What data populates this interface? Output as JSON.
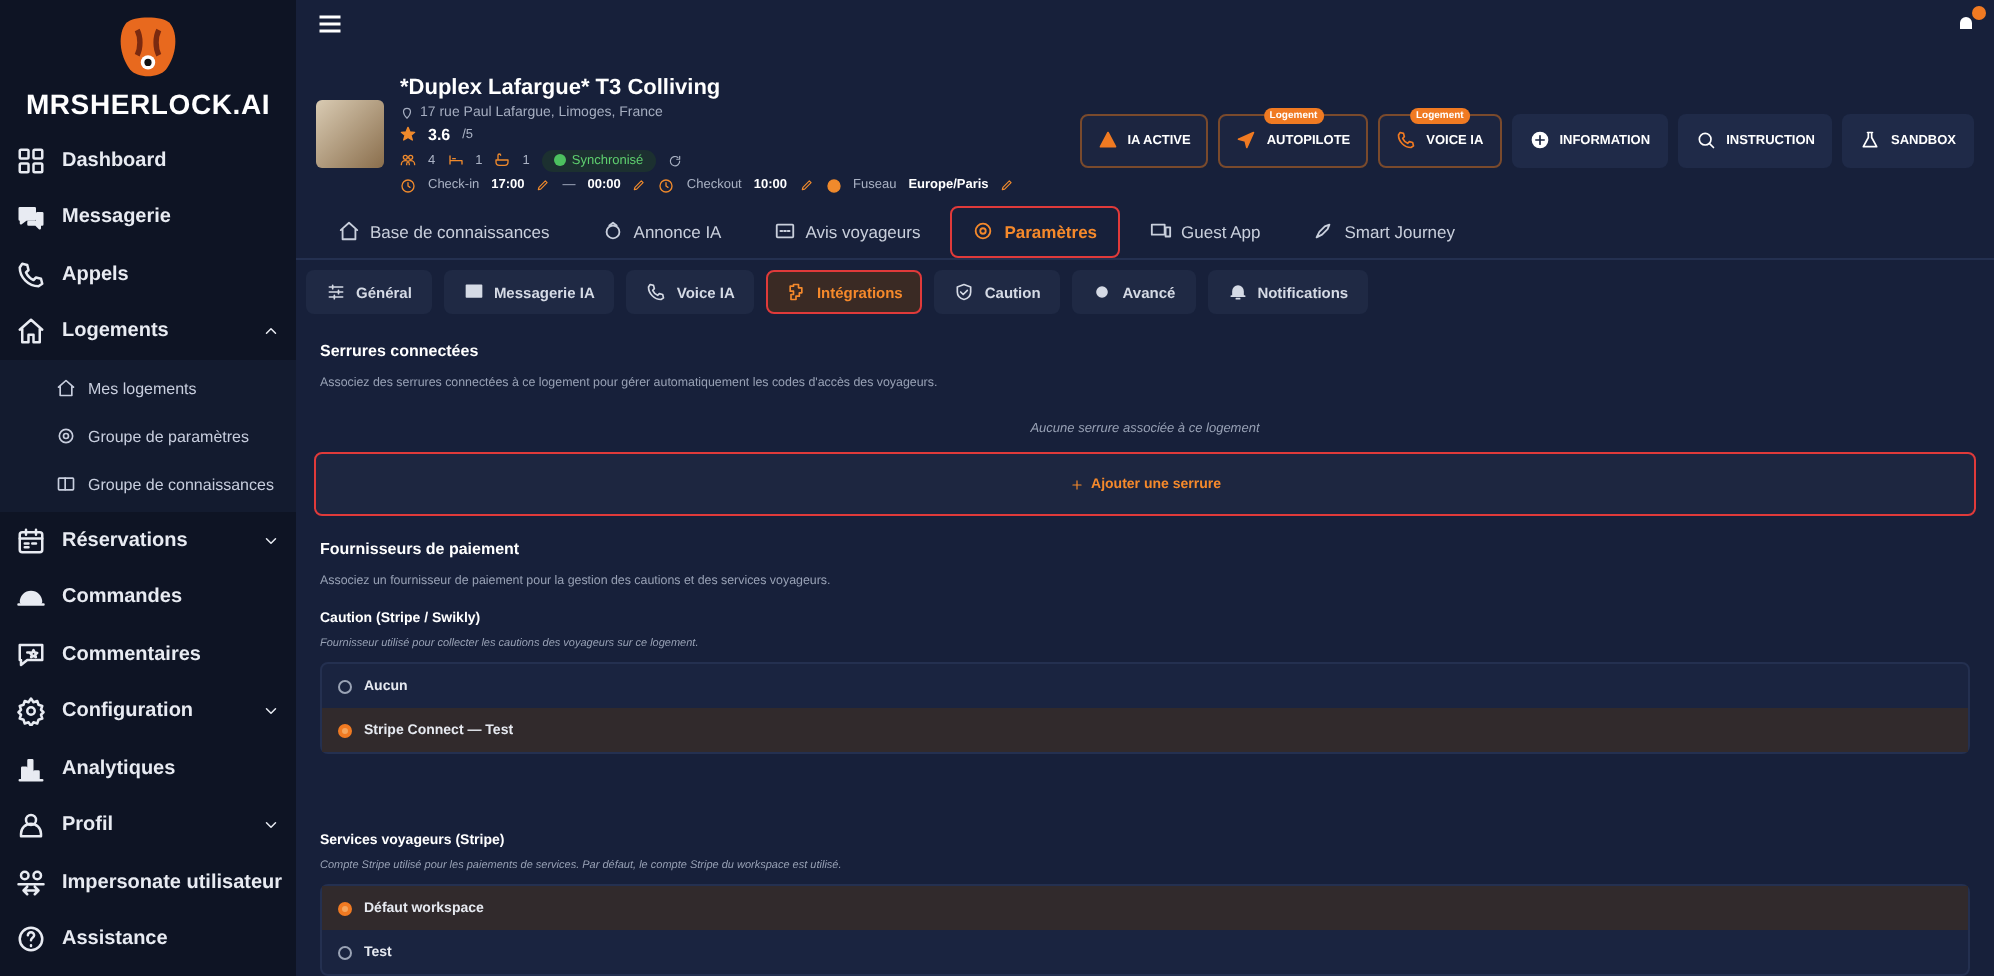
{
  "brand": {
    "name": "MRSHERLOCK.AI"
  },
  "sidebar": {
    "items": [
      {
        "label": "Dashboard",
        "selected": false
      },
      {
        "label": "Messagerie",
        "selected": false
      },
      {
        "label": "Appels",
        "selected": false
      },
      {
        "label": "Logements",
        "selected": false,
        "expanded": true,
        "children": [
          {
            "label": "Mes logements"
          },
          {
            "label": "Groupe de paramètres"
          },
          {
            "label": "Groupe de connaissances"
          }
        ]
      },
      {
        "label": "Réservations",
        "selected": false,
        "expanded": false
      },
      {
        "label": "Commandes",
        "selected": false
      },
      {
        "label": "Commentaires",
        "selected": false
      },
      {
        "label": "Configuration",
        "selected": false,
        "expanded": false
      },
      {
        "label": "Analytiques",
        "selected": false
      },
      {
        "label": "Profil",
        "selected": false,
        "expanded": false
      },
      {
        "label": "Impersonate utilisateur",
        "selected": false
      },
      {
        "label": "Assistance",
        "selected": false
      }
    ]
  },
  "property": {
    "title": "*Duplex Lafargue* T3 Colliving",
    "address": "17 rue Paul Lafargue, Limoges, France",
    "rating": "3.6",
    "rating_max": "/5",
    "guests": "4",
    "bedrooms": "1",
    "bathrooms": "1",
    "sync_status": "Synchronisé",
    "checkin_label": "Check-in",
    "checkin": "17:00",
    "checkin_sep": "—",
    "checkin_end": "00:00",
    "checkout_label": "Checkout",
    "checkout": "10:00",
    "timezone_label": "Fuseau",
    "timezone": "Europe/Paris"
  },
  "actions": [
    {
      "label": "IA ACTIVE",
      "kind": "status"
    },
    {
      "label": "AUTOPILOTE",
      "kind": "status",
      "badge": "Logement"
    },
    {
      "label": "VOICE IA",
      "kind": "status",
      "badge": "Logement"
    },
    {
      "label": "INFORMATION",
      "kind": "plain"
    },
    {
      "label": "INSTRUCTION",
      "kind": "plain"
    },
    {
      "label": "SANDBOX",
      "kind": "plain"
    }
  ],
  "tabs": [
    {
      "label": "Base de connaissances",
      "selected": false,
      "highlighted": false
    },
    {
      "label": "Annonce IA",
      "selected": false,
      "highlighted": false
    },
    {
      "label": "Avis voyageurs",
      "selected": false,
      "highlighted": false
    },
    {
      "label": "Paramètres",
      "selected": true,
      "highlighted": true
    },
    {
      "label": "Guest App",
      "selected": false,
      "highlighted": false
    },
    {
      "label": "Smart Journey",
      "selected": false,
      "highlighted": false
    }
  ],
  "subtabs": [
    {
      "label": "Général",
      "selected": false,
      "highlighted": false
    },
    {
      "label": "Messagerie IA",
      "selected": false,
      "highlighted": false
    },
    {
      "label": "Voice IA",
      "selected": false,
      "highlighted": false
    },
    {
      "label": "Intégrations",
      "selected": true,
      "highlighted": true
    },
    {
      "label": "Caution",
      "selected": false,
      "highlighted": false
    },
    {
      "label": "Avancé",
      "selected": false,
      "highlighted": false
    },
    {
      "label": "Notifications",
      "selected": false,
      "highlighted": false
    }
  ],
  "locks": {
    "title": "Serrures connectées",
    "description": "Associez des serrures connectées à ce logement pour gérer automatiquement les codes d'accès des voyageurs.",
    "empty": "Aucune serrure associée à ce logement",
    "add_button": {
      "label": "Ajouter une serrure",
      "highlighted": true
    }
  },
  "payments": {
    "title": "Fournisseurs de paiement",
    "description": "Associez un fournisseur de paiement pour la gestion des cautions et des services voyageurs.",
    "groups": [
      {
        "title": "Caution (Stripe / Swikly)",
        "hint": "Fournisseur utilisé pour collecter les cautions des voyageurs sur ce logement.",
        "options": [
          {
            "label": "Aucun",
            "selected": false
          },
          {
            "label": "Stripe Connect — Test",
            "selected": true
          }
        ]
      },
      {
        "title": "Services voyageurs (Stripe)",
        "hint": "Compte Stripe utilisé pour les paiements de services. Par défaut, le compte Stripe du workspace est utilisé.",
        "options": [
          {
            "label": "Défaut workspace",
            "selected": true
          },
          {
            "label": "Test",
            "selected": false
          }
        ]
      }
    ]
  }
}
